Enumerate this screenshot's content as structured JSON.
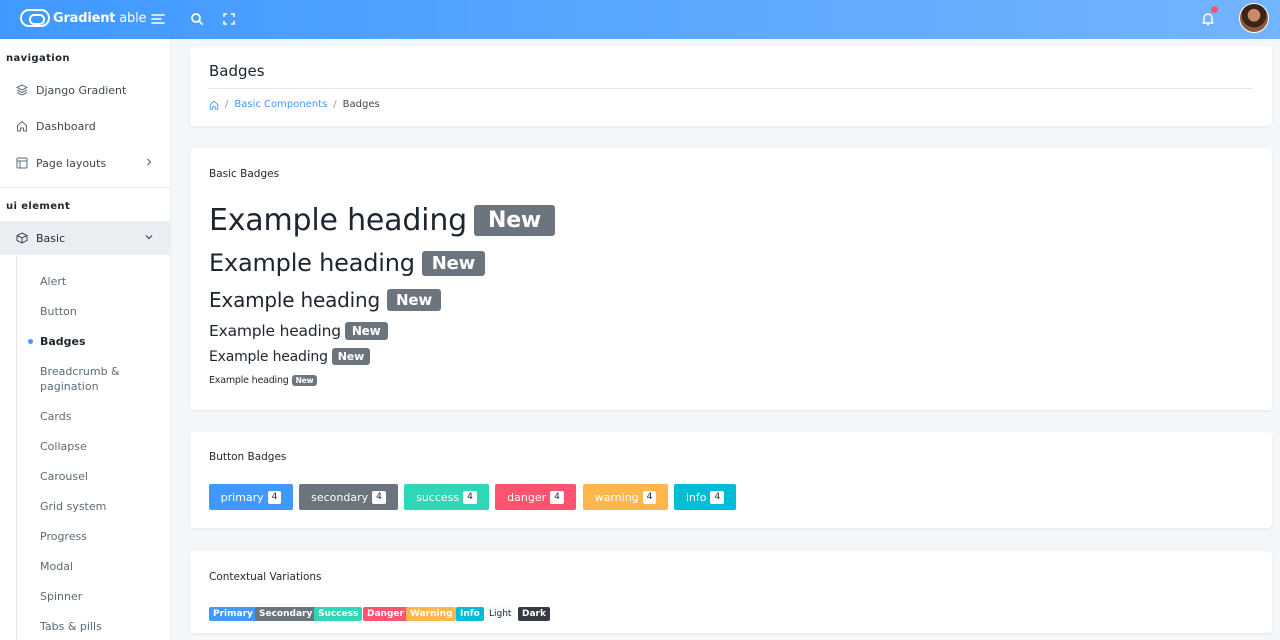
{
  "header": {
    "brand_bold": "Gradient",
    "brand_light": " able",
    "icons": [
      "menu-icon",
      "search-icon",
      "fullscreen-icon",
      "bell-icon",
      "avatar"
    ]
  },
  "sidebar": {
    "caption_navigation": "navigation",
    "items": [
      {
        "label": "Django Gradient",
        "icon": "layers-icon"
      },
      {
        "label": "Dashboard",
        "icon": "home-icon"
      },
      {
        "label": "Page layouts",
        "icon": "layout-icon"
      }
    ],
    "caption_ui": "ui element",
    "basic_label": "Basic",
    "sub_items": [
      "Alert",
      "Button",
      "Badges",
      "Breadcrumb &",
      "pagination",
      "Cards",
      "Collapse",
      "Carousel",
      "Grid system",
      "Progress",
      "Modal",
      "Spinner",
      "Tabs & pills"
    ]
  },
  "page": {
    "title": "Badges",
    "breadcrumb": {
      "parent": "Basic Components",
      "current": "Badges"
    }
  },
  "basic": {
    "title": "Basic Badges",
    "heading": "Example heading",
    "badge": "New"
  },
  "buttons": {
    "title": "Button Badges",
    "items": [
      {
        "label": "primary",
        "count": "4",
        "color": "#4099ff"
      },
      {
        "label": "secondary",
        "count": "4",
        "color": "#6c757d"
      },
      {
        "label": "success",
        "count": "4",
        "color": "#2ed8b6"
      },
      {
        "label": "danger",
        "count": "4",
        "color": "#ff5370"
      },
      {
        "label": "warning",
        "count": "4",
        "color": "#ffb64d"
      },
      {
        "label": "info",
        "count": "4",
        "color": "#00bcd4"
      }
    ]
  },
  "contextual": {
    "title": "Contextual Variations",
    "items": [
      {
        "label": "Primary",
        "color": "#4099ff"
      },
      {
        "label": "Secondary",
        "color": "#6c757d"
      },
      {
        "label": "Success",
        "color": "#2ed8b6"
      },
      {
        "label": "Danger",
        "color": "#ff5370"
      },
      {
        "label": "Warning",
        "color": "#ffb64d"
      },
      {
        "label": "Info",
        "color": "#00bcd4"
      },
      {
        "label": "Light",
        "color": "#f8f9fa"
      },
      {
        "label": "Dark",
        "color": "#343a40"
      }
    ]
  }
}
